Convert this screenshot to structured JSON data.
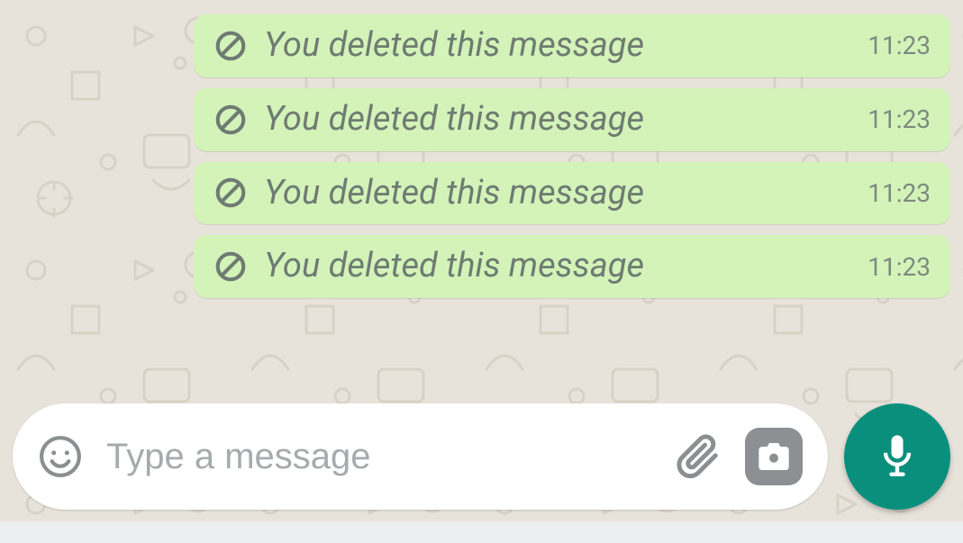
{
  "messages": [
    {
      "deleted": true,
      "text": "You deleted this message",
      "time": "11:23"
    },
    {
      "deleted": true,
      "text": "You deleted this message",
      "time": "11:23"
    },
    {
      "deleted": true,
      "text": "You deleted this message",
      "time": "11:23"
    },
    {
      "deleted": true,
      "text": "You deleted this message",
      "time": "11:23"
    }
  ],
  "composer": {
    "placeholder": "Type a message"
  },
  "icons": {
    "prohibit": "prohibit-icon",
    "emoji": "emoji-icon",
    "attach": "paperclip-icon",
    "camera": "camera-icon",
    "mic": "microphone-icon"
  },
  "colors": {
    "bubble": "#d3f3b9",
    "fab": "#0b8f7d",
    "bg": "#e8e3da"
  }
}
